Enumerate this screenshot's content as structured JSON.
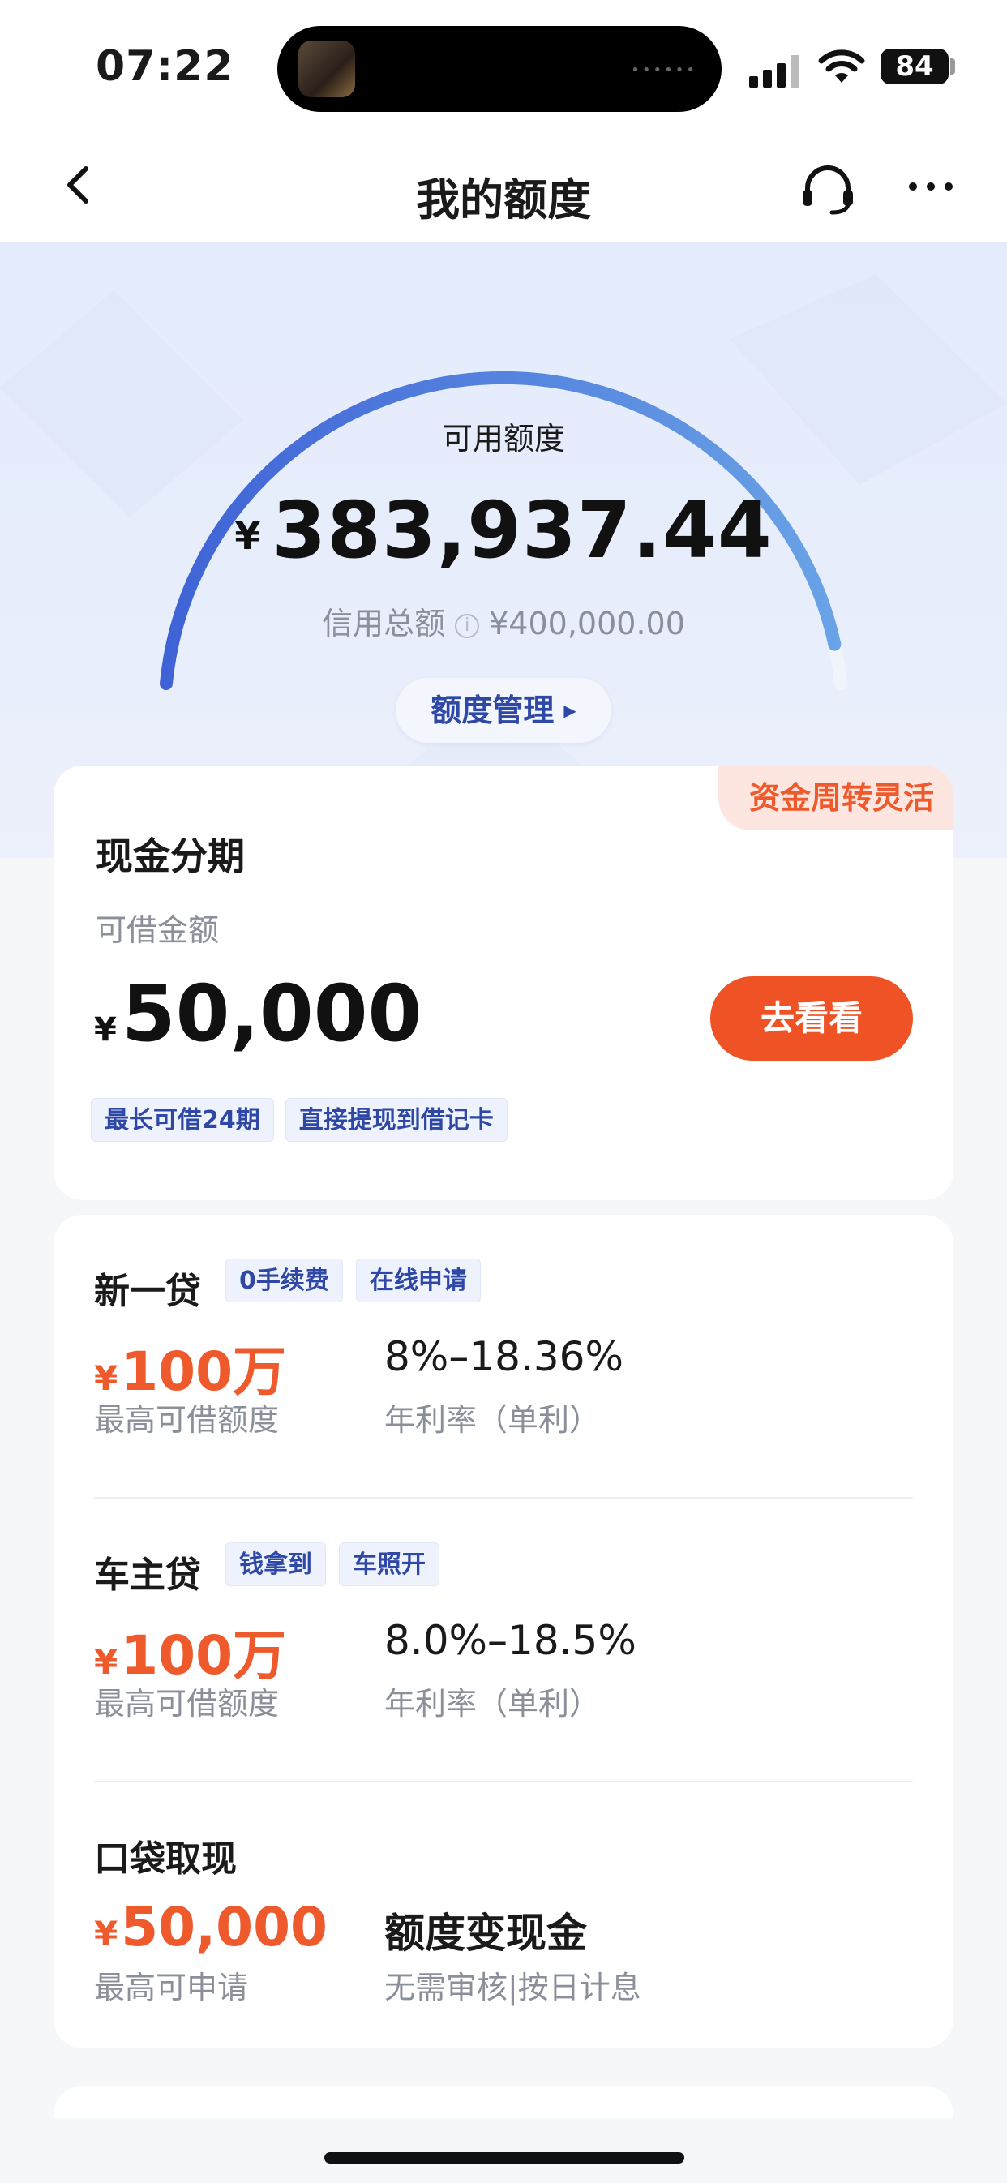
{
  "status_bar": {
    "time": "07:22",
    "battery": "84",
    "icons": [
      "signal-icon",
      "wifi-icon",
      "battery-icon"
    ]
  },
  "nav": {
    "title": "我的额度",
    "icons": [
      "back-icon",
      "headset-icon",
      "more-icon"
    ]
  },
  "quota": {
    "available_label": "可用额度",
    "currency": "¥",
    "available_amount": "383,937.44",
    "available_fraction": 0.96,
    "total_label": "信用总额",
    "total_amount": "¥400,000.00",
    "manage_button": "额度管理"
  },
  "cash_installment": {
    "ribbon": "资金周转灵活",
    "title": "现金分期",
    "amount_label": "可借金额",
    "currency": "¥",
    "amount": "50,000",
    "button": "去看看",
    "tags": [
      "最长可借24期",
      "直接提现到借记卡"
    ]
  },
  "loans": [
    {
      "name": "新一贷",
      "tags": [
        "0手续费",
        "在线申请"
      ],
      "currency": "¥",
      "max_amount": "100万",
      "max_label": "最高可借额度",
      "rate": "8%–18.36%",
      "rate_label": "年利率（单利）"
    },
    {
      "name": "车主贷",
      "tags": [
        "钱拿到",
        "车照开"
      ],
      "currency": "¥",
      "max_amount": "100万",
      "max_label": "最高可借额度",
      "rate": "8.0%–18.5%",
      "rate_label": "年利率（单利）"
    },
    {
      "name": "口袋取现",
      "tags": [],
      "currency": "¥",
      "max_amount": "50,000",
      "max_label": "最高可申请",
      "rate": "额度变现金",
      "rate_label": "无需审核|按日计息"
    }
  ],
  "colors": {
    "accent_orange": "#ef5325",
    "accent_blue": "#2f48a6",
    "gauge_start": "#3f63d6",
    "gauge_end": "#6aa3e6"
  }
}
